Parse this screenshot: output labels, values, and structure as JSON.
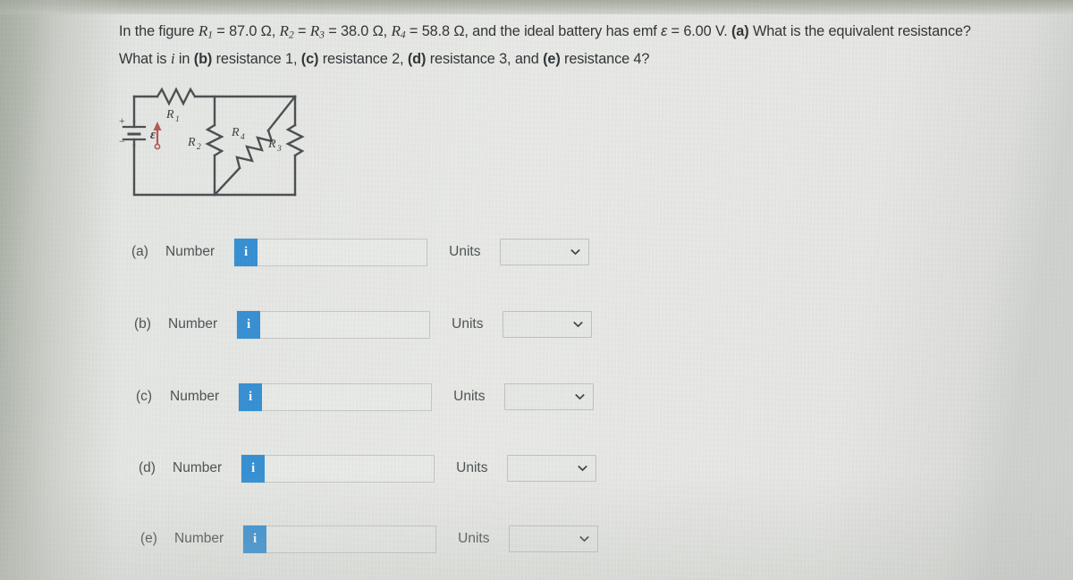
{
  "problem": {
    "line1_parts": {
      "lead": "In the figure ",
      "r1_label": "R",
      "r1_sub": "1",
      "r1_value": " = 87.0 Ω, ",
      "r2_label": "R",
      "r2_sub": "2",
      "r2_eq": " = ",
      "r3_label": "R",
      "r3_sub": "3",
      "r3_value": " = 38.0 Ω, ",
      "r4_label": "R",
      "r4_sub": "4",
      "r4_value": " = 58.8 Ω, and the ideal battery has emf ",
      "emf_symbol": "ε",
      "emf_value": " = 6.00 V. ",
      "qa_tag": "(a)",
      "qa_text": " What is the equivalent resistance?"
    },
    "line2_parts": {
      "lead": "What is ",
      "current_symbol": "i",
      "mid": " in ",
      "qb_tag": "(b)",
      "qb_text": " resistance 1, ",
      "qc_tag": "(c)",
      "qc_text": " resistance 2, ",
      "qd_tag": "(d)",
      "qd_text": " resistance 3, and ",
      "qe_tag": "(e)",
      "qe_text": " resistance 4?"
    },
    "full_text": "In the figure R1 = 87.0 Ω, R2 = R3 = 38.0 Ω, R4 = 58.8 Ω, and the ideal battery has emf ε = 6.00 V. (a) What is the equivalent resistance? What is i in (b) resistance 1, (c) resistance 2, (d) resistance 3, and (e) resistance 4?"
  },
  "figure": {
    "name": "circuit-diagram",
    "battery_plus": "+",
    "battery_minus": "−",
    "emf_label": "ε",
    "labels": {
      "r1": {
        "base": "R",
        "sub": "1"
      },
      "r2": {
        "base": "R",
        "sub": "2"
      },
      "r4": {
        "base": "R",
        "sub": "4"
      },
      "r3": {
        "base": "R",
        "sub": "3"
      }
    },
    "colors": {
      "wire": "#4a4f52",
      "emf_arrow": "#c0564f"
    }
  },
  "answers": {
    "number_label": "Number",
    "units_label": "Units",
    "info_icon_glyph": "i",
    "accent_color": "#2c93e0",
    "rows": [
      {
        "letter": "(a)",
        "value": "",
        "placeholder": "",
        "unit_selected": ""
      },
      {
        "letter": "(b)",
        "value": "",
        "placeholder": "",
        "unit_selected": ""
      },
      {
        "letter": "(c)",
        "value": "",
        "placeholder": "",
        "unit_selected": ""
      },
      {
        "letter": "(d)",
        "value": "",
        "placeholder": "",
        "unit_selected": ""
      },
      {
        "letter": "(e)",
        "value": "",
        "placeholder": "",
        "unit_selected": ""
      }
    ]
  }
}
